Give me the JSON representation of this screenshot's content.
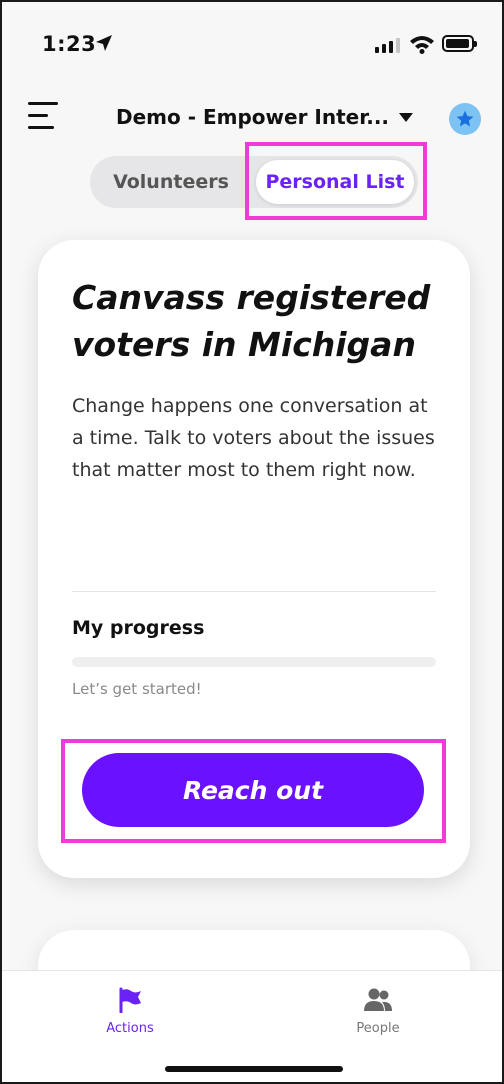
{
  "status_bar": {
    "time": "1:23"
  },
  "header": {
    "org_name": "Demo - Empower Inter..."
  },
  "tabs": [
    {
      "label": "Volunteers",
      "selected": false
    },
    {
      "label": "Personal List",
      "selected": true
    }
  ],
  "card": {
    "title": "Canvass registered voters in Michigan",
    "description": "Change happens one conversation at a time. Talk to voters about the issues that matter most to them right now.",
    "progress_label": "My progress",
    "progress_fraction": 0,
    "progress_status": "Let’s get started!",
    "cta_label": "Reach out"
  },
  "bottom_nav": {
    "items": [
      {
        "label": "Actions",
        "icon": "flag-icon",
        "active": true
      },
      {
        "label": "People",
        "icon": "people-icon",
        "active": false
      }
    ]
  },
  "colors": {
    "accent": "#6a12ff",
    "highlight": "#f03bd6",
    "star_badge": "#7cc2f3"
  }
}
